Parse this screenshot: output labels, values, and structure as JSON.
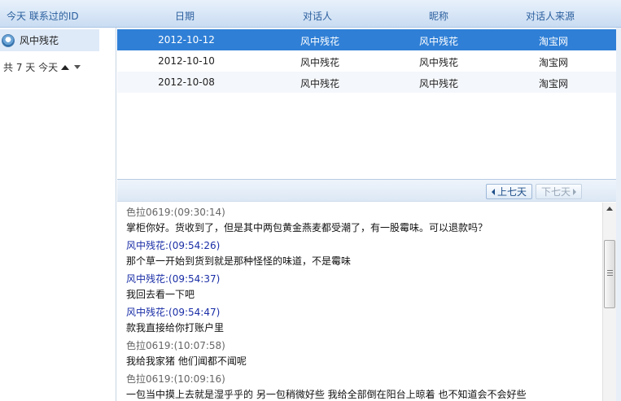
{
  "header": {
    "left_title": "今天 联系过的ID",
    "columns": [
      "日期",
      "对话人",
      "昵称",
      "对话人来源"
    ]
  },
  "sidebar": {
    "contact": "风中残花",
    "summary": "共 7 天 今天",
    "icon": "avatar-icon"
  },
  "table": {
    "rows": [
      {
        "date": "2012-10-12",
        "talker": "风中残花",
        "nickname": "风中残花",
        "source": "淘宝网",
        "selected": true
      },
      {
        "date": "2012-10-10",
        "talker": "风中残花",
        "nickname": "风中残花",
        "source": "淘宝网",
        "selected": false
      },
      {
        "date": "2012-10-08",
        "talker": "风中残花",
        "nickname": "风中残花",
        "source": "淘宝网",
        "selected": false
      }
    ]
  },
  "pager": {
    "prev_label": "上七天",
    "next_label": "下七天"
  },
  "chat": {
    "messages": [
      {
        "speaker": "色拉0619:",
        "time": "(09:30:14)",
        "text": "掌柜你好。货收到了，但是其中两包黄金燕麦都受潮了，有一股霉味。可以退款吗？",
        "side": "them"
      },
      {
        "speaker": "风中残花:",
        "time": "(09:54:26)",
        "text": "那个草一开始到货到就是那种怪怪的味道，不是霉味",
        "side": "me"
      },
      {
        "speaker": "风中残花:",
        "time": "(09:54:37)",
        "text": "我回去看一下吧",
        "side": "me"
      },
      {
        "speaker": "风中残花:",
        "time": "(09:54:47)",
        "text": "款我直接给你打账户里",
        "side": "me"
      },
      {
        "speaker": "色拉0619:",
        "time": "(10:07:58)",
        "text": "我给我家猪 他们闻都不闻呢",
        "side": "them"
      },
      {
        "speaker": "色拉0619:",
        "time": "(10:09:16)",
        "text": "一包当中摸上去就是湿乎乎的 另一包稍微好些 我给全部倒在阳台上晾着 也不知道会不会好些",
        "side": "them"
      }
    ]
  },
  "colors": {
    "selected_row": "#2f7fd6",
    "my_name": "#1a2ea6",
    "their_name": "#666666"
  }
}
